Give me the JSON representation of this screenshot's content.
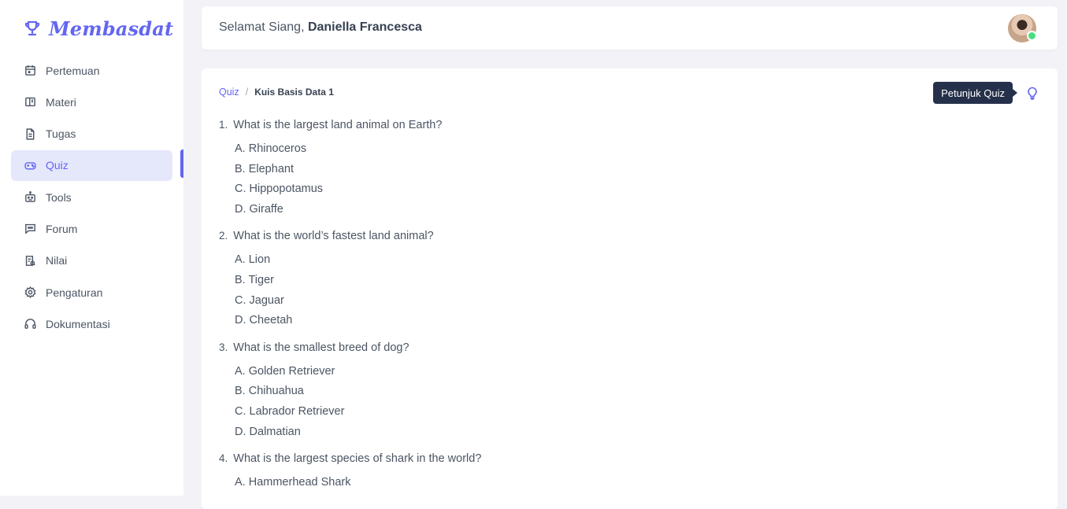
{
  "brand": {
    "name": "Membasdat",
    "icon": "trophy-icon",
    "accent": "#6366f1"
  },
  "sidebar": {
    "items": [
      {
        "label": "Pertemuan",
        "icon": "calendar-icon",
        "active": false
      },
      {
        "label": "Materi",
        "icon": "book-icon",
        "active": false
      },
      {
        "label": "Tugas",
        "icon": "document-icon",
        "active": false
      },
      {
        "label": "Quiz",
        "icon": "gamepad-icon",
        "active": true
      },
      {
        "label": "Tools",
        "icon": "robot-icon",
        "active": false
      },
      {
        "label": "Forum",
        "icon": "chat-icon",
        "active": false
      },
      {
        "label": "Nilai",
        "icon": "report-icon",
        "active": false
      },
      {
        "label": "Pengaturan",
        "icon": "gear-icon",
        "active": false
      },
      {
        "label": "Dokumentasi",
        "icon": "headphones-icon",
        "active": false
      }
    ]
  },
  "header": {
    "greeting_prefix": "Selamat Siang, ",
    "user_name": "Daniella Francesca",
    "status_color": "#4ade80"
  },
  "breadcrumb": {
    "parent": "Quiz",
    "separator": "/",
    "current": "Kuis Basis Data 1"
  },
  "hint": {
    "tooltip": "Petunjuk Quiz",
    "icon": "lightbulb-icon"
  },
  "questions": [
    {
      "number": "1.",
      "text": "What is the largest land animal on Earth?",
      "options": [
        "A. Rhinoceros",
        "B. Elephant",
        "C. Hippopotamus",
        "D. Giraffe"
      ]
    },
    {
      "number": "2.",
      "text": "What is the world’s fastest land animal?",
      "options": [
        "A. Lion",
        "B. Tiger",
        "C. Jaguar",
        "D. Cheetah"
      ]
    },
    {
      "number": "3.",
      "text": "What is the smallest breed of dog?",
      "options": [
        "A. Golden Retriever",
        "B. Chihuahua",
        "C. Labrador Retriever",
        "D. Dalmatian"
      ]
    },
    {
      "number": "4.",
      "text": "What is the largest species of shark in the world?",
      "options": [
        "A. Hammerhead Shark"
      ]
    }
  ]
}
